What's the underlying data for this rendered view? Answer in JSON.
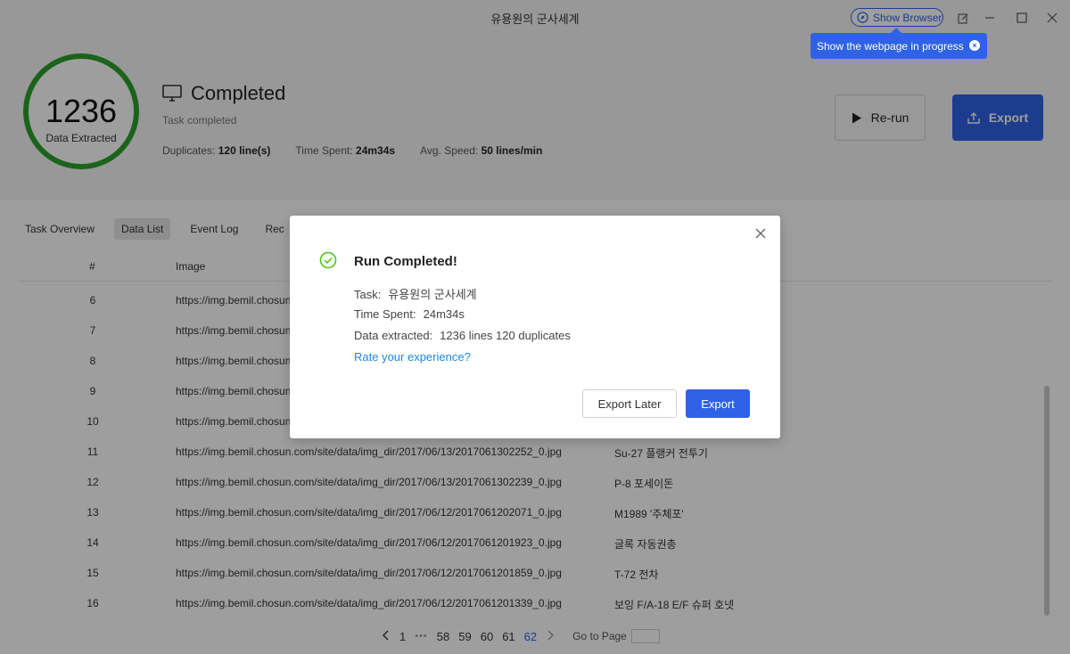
{
  "window": {
    "title": "유용원의 군사세계",
    "show_browser_label": "Show Browser",
    "tooltip": "Show the webpage in progress"
  },
  "summary": {
    "count": "1236",
    "count_label": "Data Extracted",
    "status": "Completed",
    "task_status": "Task completed",
    "duplicates_label": "Duplicates:",
    "duplicates_value": "120 line(s)",
    "time_label": "Time Spent:",
    "time_value": "24m34s",
    "speed_label": "Avg. Speed:",
    "speed_value": "50 lines/min",
    "rerun_label": "Re-run",
    "export_label": "Export",
    "ring_color": "#2ca02c",
    "accent_color": "#2f62e6"
  },
  "tabs": [
    {
      "label": "Task Overview",
      "active": false
    },
    {
      "label": "Data List",
      "active": true
    },
    {
      "label": "Event Log",
      "active": false
    },
    {
      "label": "Rec",
      "active": false
    }
  ],
  "table": {
    "headers": {
      "num": "#",
      "image": "Image"
    },
    "rows": [
      {
        "num": "6",
        "image": "https://img.bemil.chosun",
        "title": ""
      },
      {
        "num": "7",
        "image": "https://img.bemil.chosun",
        "title": ""
      },
      {
        "num": "8",
        "image": "https://img.bemil.chosun",
        "title": ""
      },
      {
        "num": "9",
        "image": "https://img.bemil.chosun",
        "title": ""
      },
      {
        "num": "10",
        "image": "https://img.bemil.chosun",
        "title": ""
      },
      {
        "num": "11",
        "image": "https://img.bemil.chosun.com/site/data/img_dir/2017/06/13/2017061302252_0.jpg",
        "title": "Su-27 플랭커 전투기"
      },
      {
        "num": "12",
        "image": "https://img.bemil.chosun.com/site/data/img_dir/2017/06/13/2017061302239_0.jpg",
        "title": "P-8 포세이돈"
      },
      {
        "num": "13",
        "image": "https://img.bemil.chosun.com/site/data/img_dir/2017/06/12/2017061202071_0.jpg",
        "title": "M1989 '주체포'"
      },
      {
        "num": "14",
        "image": "https://img.bemil.chosun.com/site/data/img_dir/2017/06/12/2017061201923_0.jpg",
        "title": "글록 자동권총"
      },
      {
        "num": "15",
        "image": "https://img.bemil.chosun.com/site/data/img_dir/2017/06/12/2017061201859_0.jpg",
        "title": "T-72 전차"
      },
      {
        "num": "16",
        "image": "https://img.bemil.chosun.com/site/data/img_dir/2017/06/12/2017061201339_0.jpg",
        "title": "보잉 F/A-18 E/F 슈퍼 호넷"
      }
    ]
  },
  "pagination": {
    "first": "1",
    "ellipsis": "•••",
    "pages": [
      "58",
      "59",
      "60",
      "61",
      "62"
    ],
    "current": "62",
    "goto_label": "Go to Page"
  },
  "dialog": {
    "title": "Run Completed!",
    "task_label": "Task:",
    "task_value": "유용원의 군사세계",
    "time_label": "Time Spent:",
    "time_value": "24m34s",
    "data_label": "Data extracted:",
    "data_value": "1236 lines 120 duplicates",
    "link": "Rate your experience?",
    "later_label": "Export Later",
    "export_label": "Export"
  }
}
